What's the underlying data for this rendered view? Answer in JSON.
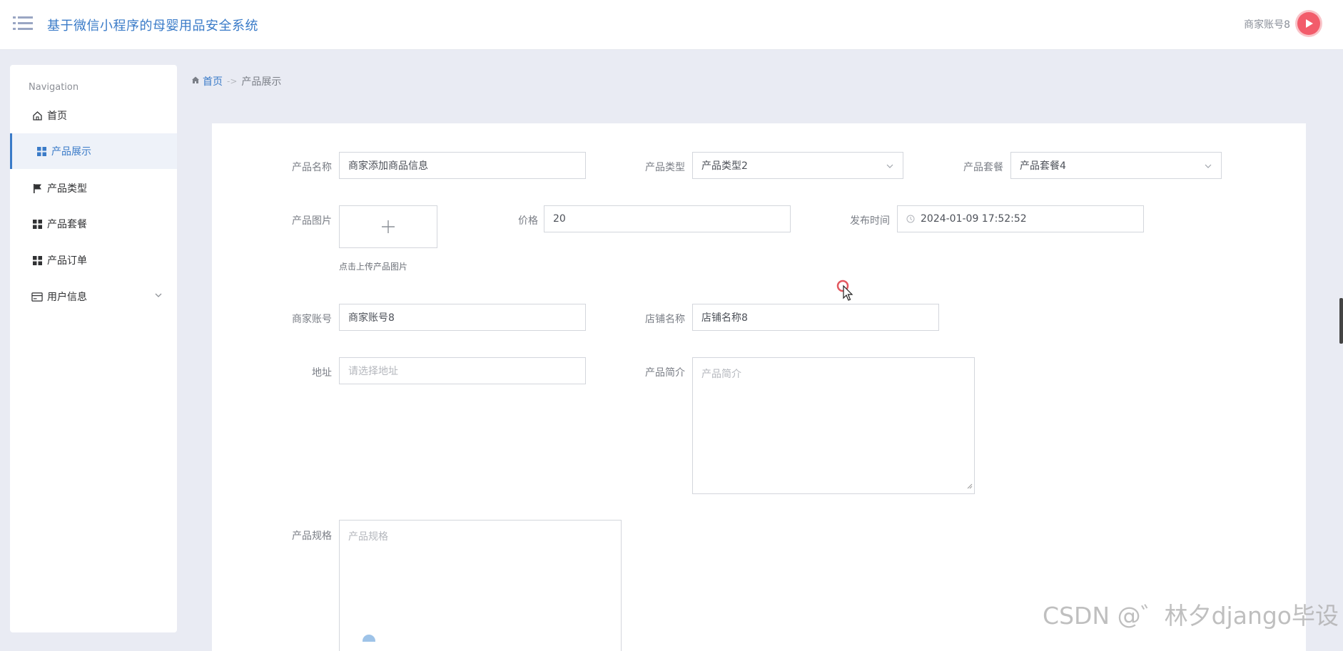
{
  "header": {
    "title": "基于微信小程序的母婴用品安全系统",
    "user_name": "商家账号8"
  },
  "sidebar": {
    "heading": "Navigation",
    "items": [
      {
        "label": "首页",
        "icon": "home-icon"
      },
      {
        "label": "产品展示",
        "icon": "grid-icon",
        "active": true
      },
      {
        "label": "产品类型",
        "icon": "flag-icon"
      },
      {
        "label": "产品套餐",
        "icon": "grid-icon"
      },
      {
        "label": "产品订单",
        "icon": "grid-icon"
      },
      {
        "label": "用户信息",
        "icon": "card-icon",
        "has_submenu": true
      }
    ]
  },
  "breadcrumb": {
    "home": "首页",
    "separator": "->",
    "current": "产品展示"
  },
  "form": {
    "product_name": {
      "label": "产品名称",
      "value": "商家添加商品信息"
    },
    "product_type": {
      "label": "产品类型",
      "value": "产品类型2"
    },
    "product_package": {
      "label": "产品套餐",
      "value": "产品套餐4"
    },
    "product_image": {
      "label": "产品图片",
      "hint": "点击上传产品图片"
    },
    "price": {
      "label": "价格",
      "value": "20"
    },
    "publish_time": {
      "label": "发布时间",
      "value": "2024-01-09 17:52:52"
    },
    "merchant_account": {
      "label": "商家账号",
      "value": "商家账号8"
    },
    "shop_name": {
      "label": "店铺名称",
      "value": "店铺名称8"
    },
    "address": {
      "label": "地址",
      "placeholder": "请选择地址"
    },
    "product_intro": {
      "label": "产品简介",
      "placeholder": "产品简介"
    },
    "product_spec": {
      "label": "产品规格",
      "placeholder": "产品规格"
    }
  },
  "watermark": "CSDN @゛林夕django毕设",
  "colors": {
    "accent": "#3a7bc8",
    "background": "#e9ebf3",
    "avatar": "#f25c6b"
  }
}
